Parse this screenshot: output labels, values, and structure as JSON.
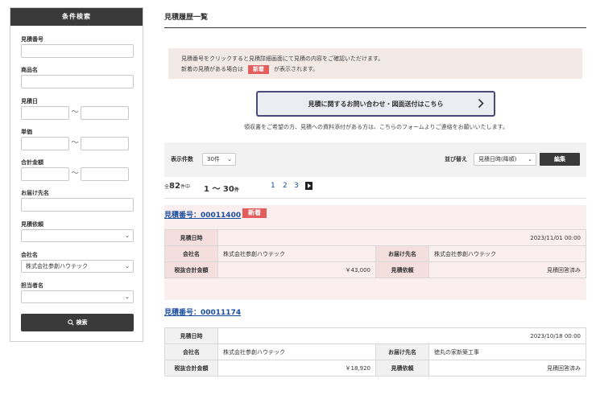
{
  "sidebar": {
    "title": "条件検索",
    "fields": {
      "quote_number": "見積番号",
      "product_name": "商品名",
      "quote_date": "見積日",
      "unit_price": "単価",
      "total_amount": "合計金額",
      "delivery_dest": "お届け先名",
      "quote_request": "見積依頼",
      "company": "会社名",
      "person": "担当者名"
    },
    "range_sep": "〜",
    "company_value": "株式会社参創ハウテック",
    "search_label": "検索"
  },
  "main": {
    "title": "見積履歴一覧",
    "notice_line1": "見積番号をクリックすると見積詳細画面にて見積の内容をご確認いただけます。",
    "notice_line2_pre": "新着の見積がある場合は",
    "notice_badge": "新着",
    "notice_line2_post": "が表示されます。",
    "contact_button": "見積に関するお問い合わせ・図面送付はこちら",
    "contact_note": "領収書をご希望の方、見積への資料添付がある方は、こちらのフォームよりご連絡をお願いいたします。",
    "controls": {
      "per_page_label": "表示件数",
      "per_page_value": "30件",
      "sort_label": "並び替え",
      "sort_value": "見積日時(降順)",
      "apply_label": "編集"
    },
    "pager": {
      "total_prefix": "全",
      "total": "82",
      "total_suffix": "件中",
      "range": "1 〜 30",
      "range_suffix": "件",
      "pages": [
        "1",
        "2",
        "3"
      ]
    },
    "records": [
      {
        "quote_no": "見積番号：00011400",
        "badge": "新着",
        "date_label": "見積日時",
        "date": "2023/11/01 00:00",
        "company_label": "会社名",
        "company": "株式会社参創ハウテック",
        "dest_label": "お届け先名",
        "dest": "株式会社参創ハウテック",
        "amount_label": "税抜合計金額",
        "amount": "￥43,000",
        "req_label": "見積依頼",
        "req": "見積回答済み"
      },
      {
        "quote_no": "見積番号：00011174",
        "date_label": "見積日時",
        "date": "2023/10/18 00:00",
        "company_label": "会社名",
        "company": "株式会社参創ハウテック",
        "dest_label": "お届け先名",
        "dest": "徳丸の家新築工事",
        "amount_label": "税抜合計金額",
        "amount": "￥18,920",
        "req_label": "見積依頼",
        "req": "見積回答済み"
      }
    ]
  },
  "colors": {
    "dark": "#3a3a3a",
    "accent_red": "#e35d5d",
    "link_blue": "#1a4fa0",
    "notice_bg": "#f3e9e7",
    "highlight_bg": "#fbeeee"
  }
}
